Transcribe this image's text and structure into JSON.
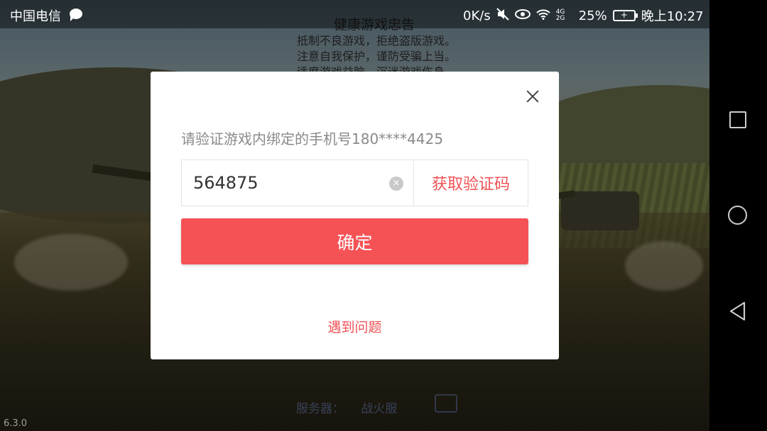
{
  "status_bar": {
    "carrier": "中国电信",
    "net_speed": "0K/s",
    "network": "4G 2G",
    "battery": "25%",
    "time": "晚上10:27"
  },
  "background": {
    "health_notice": {
      "title": "健康游戏忠告",
      "lines": [
        "抵制不良游戏，拒绝盗版游戏。",
        "注意自我保护，谨防受骗上当。",
        "适度游戏益脑，沉迷游戏伤身。"
      ]
    },
    "server_label": "服务器：",
    "server_name": "战火服",
    "version": "6.3.0"
  },
  "dialog": {
    "prompt": "请验证游戏内绑定的手机号180****4425",
    "code_value": "564875",
    "clear_icon": "×",
    "get_code_label": "获取验证码",
    "confirm_label": "确定",
    "help_label": "遇到问题"
  },
  "icons": {
    "close": "close-icon",
    "clear": "clear-circle-icon",
    "mute": "mute-icon",
    "eye": "eye-icon",
    "wifi": "wifi-icon",
    "signal": "signal-icon",
    "battery": "battery-icon",
    "nav_recent": "square-icon",
    "nav_home": "circle-icon",
    "nav_back": "triangle-back-icon"
  },
  "colors": {
    "accent": "#f55255",
    "link": "#f05155",
    "dialog_bg": "#ffffff"
  }
}
